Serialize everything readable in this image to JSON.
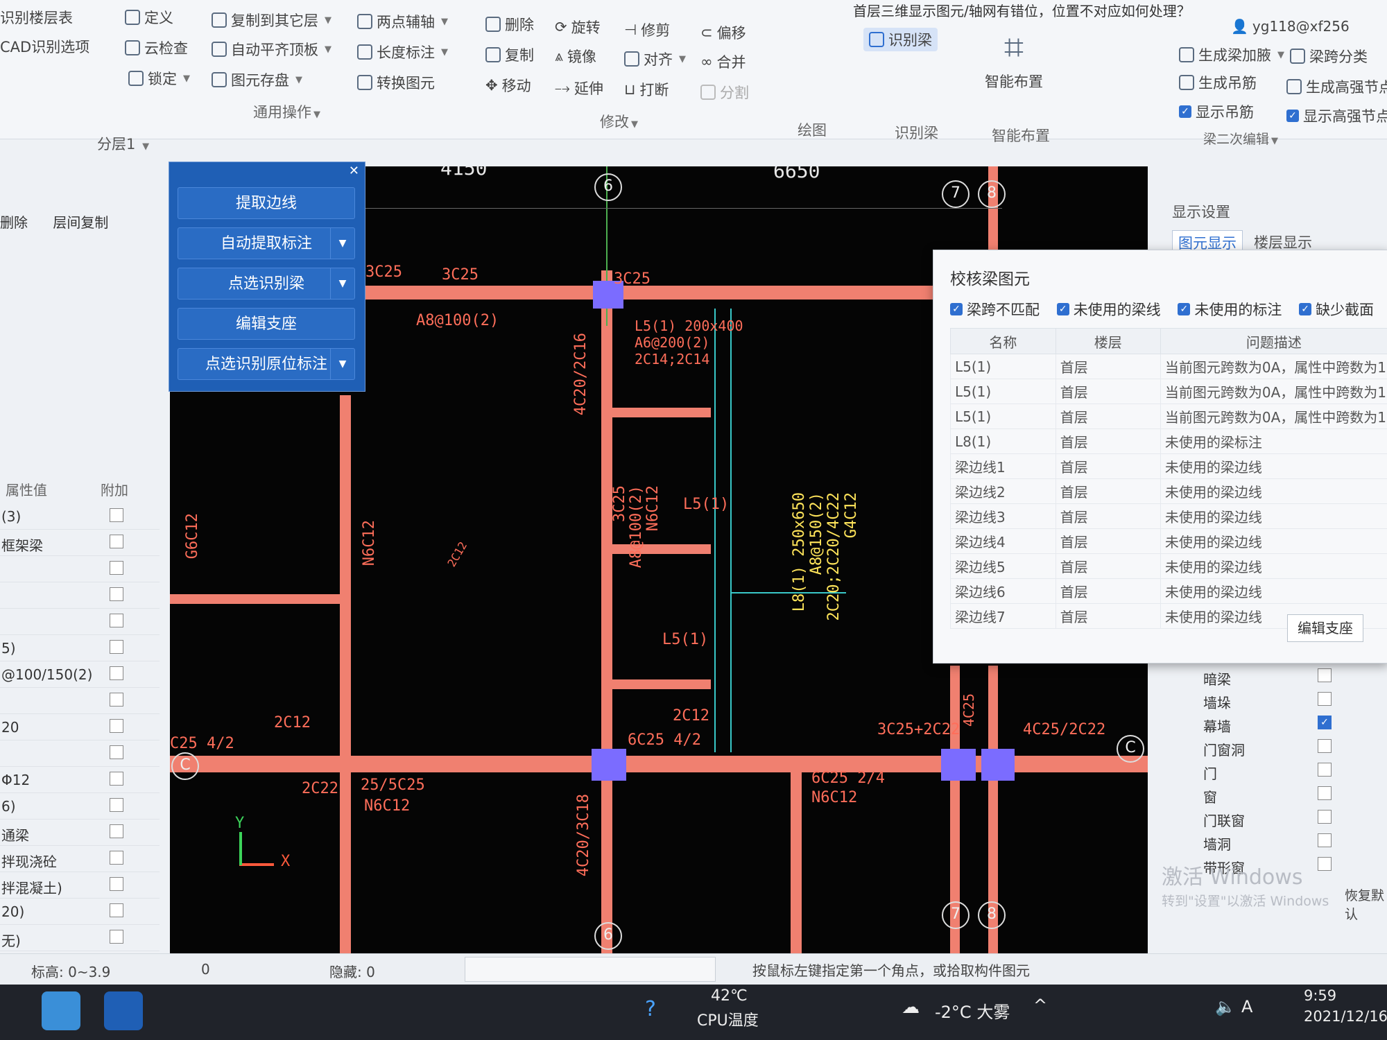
{
  "window_title": "首层三维显示图元/轴网有错位，位置不对应如何处理？",
  "user_account": "yg118@xf256",
  "ribbon": {
    "row1": [
      "识别楼层表",
      "定义",
      "复制到其它层",
      "两点辅轴",
      "删除",
      "旋转",
      "修剪",
      "偏移",
      "识别梁"
    ],
    "row2": [
      "CAD识别选项",
      "云检查",
      "自动平齐顶板",
      "长度标注",
      "复制",
      "镜像",
      "对齐",
      "合并"
    ],
    "row3": [
      "锁定",
      "图元存盘",
      "转换图元",
      "移动",
      "延伸",
      "打断",
      "分割"
    ],
    "right_items": [
      "生成梁加腋",
      "梁跨分类",
      "生成吊筋",
      "生成高强节点",
      "显示吊筋",
      "显示高强节点"
    ],
    "smart_layout": "智能布置",
    "groups": [
      "通用操作",
      "修改",
      "绘图",
      "识别梁",
      "智能布置",
      "梁二次编辑"
    ]
  },
  "floor_selector": {
    "layer": "分层1"
  },
  "left_toolbar": {
    "delete": "删除",
    "copy_between_floors": "层间复制"
  },
  "left_props": {
    "header": {
      "value": "属性值",
      "extra": "附加"
    },
    "rows": [
      "(3)",
      "框架梁",
      "",
      "",
      "",
      "5)",
      "@100/150(2)",
      "",
      "20",
      "",
      "Φ12",
      "6)",
      "通梁",
      "拌现浇砼",
      "拌混凝土)",
      "20)",
      "无)"
    ]
  },
  "identify_menu": {
    "items": [
      "提取边线",
      "自动提取标注",
      "点选识别梁",
      "编辑支座",
      "点选识别原位标注"
    ]
  },
  "cad": {
    "axis_labels": [
      "6",
      "7",
      "8",
      "C",
      "6",
      "7",
      "8",
      "C"
    ],
    "dims": [
      "4150",
      "6650"
    ],
    "annotations": {
      "t1": "3C25",
      "t2": "3C25",
      "t3": "3C25",
      "t4": "A8@100(2)",
      "t5": "L5(1) 200x400",
      "t6": "A6@200(2)",
      "t7": "2C14;2C14",
      "t8": "4C20/2C16",
      "t9": "N6C12",
      "t10": "3C25",
      "t11": "A8@100(2)",
      "t12": "N6C12",
      "t13": "L5(1)",
      "t14": "L5(1)",
      "t15": "2C12",
      "t16": "6C25 4/2",
      "t17": "2C12",
      "t18": "3C25+2C22",
      "t19": "4C25/2C22",
      "t20": "4C25",
      "t21": "2C22",
      "t22": "25/5C25",
      "t23": "N6C12",
      "t24": "6C25 2/4",
      "t25": "N6C12",
      "t26": "4C20/3C18",
      "t27": "C25 4/2",
      "t28": "2C12",
      "t29": "G6C12",
      "l8": [
        "L8(1) 250x650",
        "A8@150(2)",
        "2C20;2C20/4C22",
        "G4C12"
      ]
    },
    "ucs": {
      "x": "X",
      "y": "Y"
    }
  },
  "check_dialog": {
    "title": "校核梁图元",
    "options": [
      {
        "label": "梁跨不匹配",
        "checked": true
      },
      {
        "label": "未使用的梁线",
        "checked": true
      },
      {
        "label": "未使用的标注",
        "checked": true
      },
      {
        "label": "缺少截面",
        "checked": true
      }
    ],
    "columns": [
      "名称",
      "楼层",
      "问题描述"
    ],
    "rows": [
      [
        "L5(1)",
        "首层",
        "当前图元跨数为0A，属性中跨数为1"
      ],
      [
        "L5(1)",
        "首层",
        "当前图元跨数为0A，属性中跨数为1"
      ],
      [
        "L5(1)",
        "首层",
        "当前图元跨数为0A，属性中跨数为1"
      ],
      [
        "L8(1)",
        "首层",
        "未使用的梁标注"
      ],
      [
        "梁边线1",
        "首层",
        "未使用的梁边线"
      ],
      [
        "梁边线2",
        "首层",
        "未使用的梁边线"
      ],
      [
        "梁边线3",
        "首层",
        "未使用的梁边线"
      ],
      [
        "梁边线4",
        "首层",
        "未使用的梁边线"
      ],
      [
        "梁边线5",
        "首层",
        "未使用的梁边线"
      ],
      [
        "梁边线6",
        "首层",
        "未使用的梁边线"
      ],
      [
        "梁边线7",
        "首层",
        "未使用的梁边线"
      ]
    ],
    "edit_support": "编辑支座"
  },
  "display_panel": {
    "title": "显示设置",
    "tabs": [
      "图元显示",
      "楼层显示"
    ],
    "rows": [
      {
        "label": "暗梁",
        "checked": false
      },
      {
        "label": "墙垛",
        "checked": false
      },
      {
        "label": "幕墙",
        "checked": true
      },
      {
        "label": "门窗洞",
        "checked": false
      },
      {
        "label": "门",
        "checked": false
      },
      {
        "label": "窗",
        "checked": false
      },
      {
        "label": "门联窗",
        "checked": false
      },
      {
        "label": "墙洞",
        "checked": false
      },
      {
        "label": "带形窗",
        "checked": false
      }
    ],
    "restore_default": "恢复默认"
  },
  "watermark": {
    "line1": "激活 Windows",
    "line2": "转到\"设置\"以激活 Windows"
  },
  "statusbar": {
    "elevation": "标高:  0~3.9",
    "count": "0",
    "hidden": "隐藏: 0",
    "prompt": "按鼠标左键指定第一个角点，或拾取构件图元"
  },
  "taskbar": {
    "cpu_temp": "42℃",
    "cpu_label": "CPU温度",
    "weather": "-2°C 大雾",
    "ime": "A",
    "time": "9:59",
    "date": "2021/12/16"
  },
  "colors": {
    "beam": "#f08070",
    "column": "#7b6cff",
    "accent": "#2f6fd0",
    "menu": "#1f5fb5"
  }
}
